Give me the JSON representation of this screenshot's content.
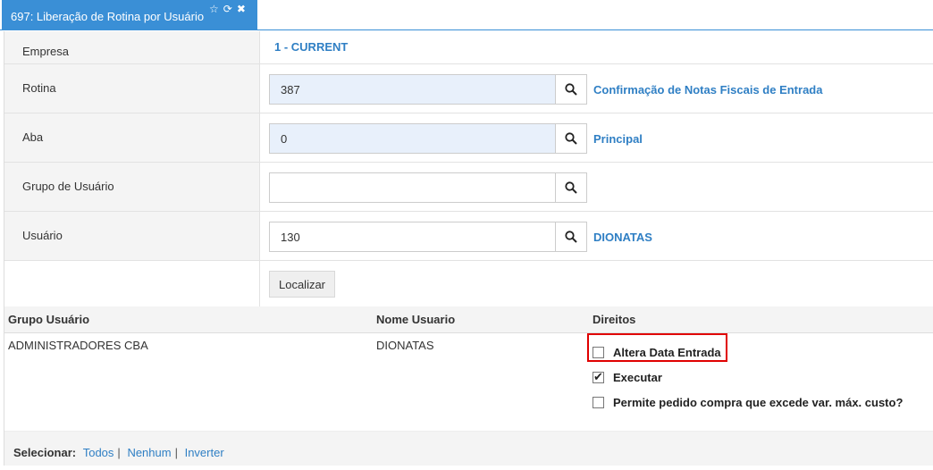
{
  "tab": {
    "title": "697: Liberação de Rotina por Usuário",
    "icons": [
      "star-icon",
      "refresh-icon",
      "close-icon"
    ]
  },
  "form": {
    "empresa": {
      "label": "Empresa",
      "value": "1 - CURRENT"
    },
    "rotina": {
      "label": "Rotina",
      "value": "387",
      "description": "Confirmação de Notas Fiscais de Entrada"
    },
    "aba": {
      "label": "Aba",
      "value": "0",
      "description": "Principal"
    },
    "grupo_usuario": {
      "label": "Grupo de Usuário",
      "value": ""
    },
    "usuario": {
      "label": "Usuário",
      "value": "130",
      "description": "DIONATAS"
    },
    "localizar_label": "Localizar"
  },
  "table": {
    "headers": [
      "Grupo Usuário",
      "Nome Usuario",
      "Direitos"
    ],
    "row": {
      "grupo": "ADMINISTRADORES CBA",
      "nome": "DIONATAS",
      "rights": [
        {
          "label": "Altera Data Entrada",
          "checked": false
        },
        {
          "label": "Executar",
          "checked": true
        },
        {
          "label": "Permite pedido compra que excede var. máx. custo?",
          "checked": false
        }
      ]
    }
  },
  "footer": {
    "select_label": "Selecionar:",
    "all": "Todos",
    "none": "Nenhum",
    "invert": "Inverter",
    "separator": "|"
  },
  "colors": {
    "accent": "#3a8fd6",
    "link": "#2f7fc4",
    "highlight": "#e00000"
  }
}
